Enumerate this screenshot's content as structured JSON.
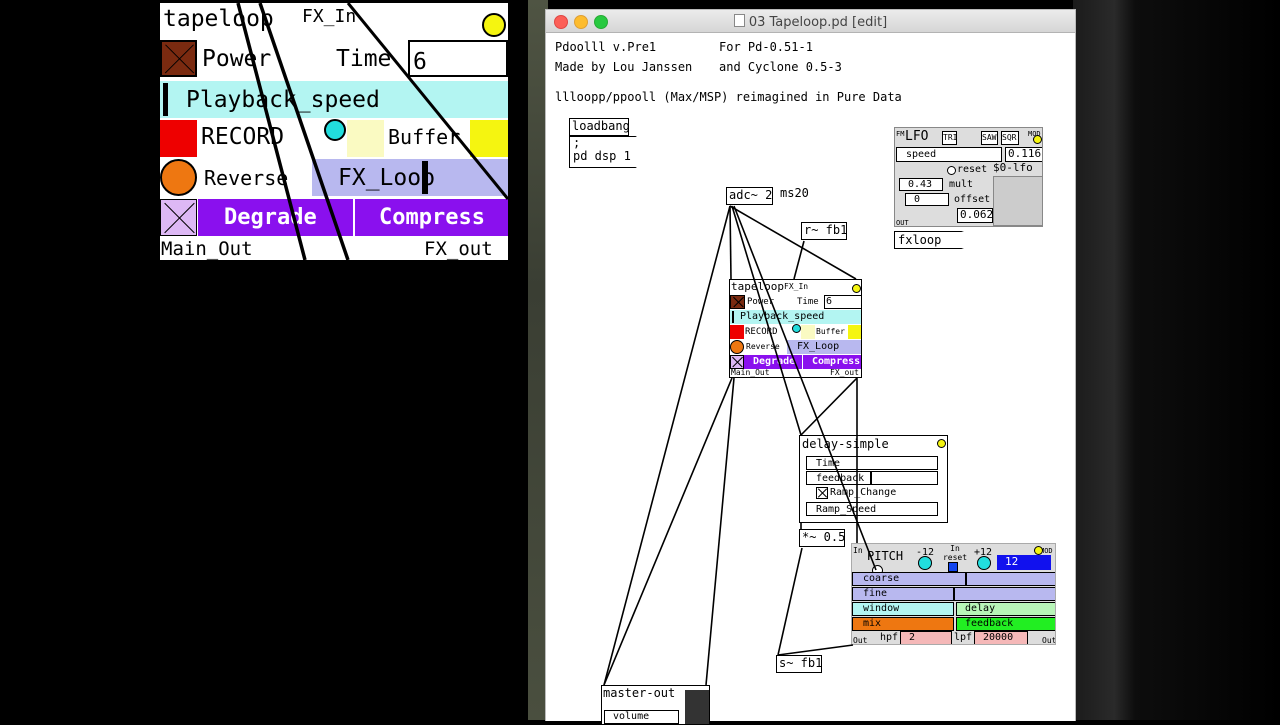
{
  "window": {
    "title": "03 Tapeloop.pd [edit]"
  },
  "zoom_panel": {
    "title": "tapeloop",
    "fx_in": "FX_In",
    "power": "Power",
    "time_label": "Time",
    "time_value": "6",
    "playback": "Playback_speed",
    "record": "RECORD",
    "buffer": "Buffer",
    "reverse": "Reverse",
    "fx_loop": "FX_Loop",
    "degrade": "Degrade",
    "compress": "Compress",
    "main_out": "Main_Out",
    "fx_out": "FX_out"
  },
  "comments": {
    "line1a": "Pdoolll v.Pre1",
    "line1b": "For Pd-0.51-1",
    "line2a": "Made by Lou Janssen",
    "line2b": "and Cyclone 0.5-3",
    "line3": "llloopp/ppooll (Max/MSP) reimagined in Pure Data",
    "ms20": "ms20"
  },
  "objects": {
    "loadbang": "loadbang",
    "dsp_msg1": ";",
    "dsp_msg2": "pd dsp 1",
    "adc": "adc~ 2",
    "rfb": "r~ fb1",
    "mul": "*~ 0.5",
    "sfb": "s~ fb1",
    "fxloop": "fxloop $1",
    "master": "master-out",
    "volume": "volume"
  },
  "tapeloop_small": {
    "title": "tapeloop",
    "fx_in": "FX_In",
    "power": "Power",
    "time_label": "Time",
    "time_value": "6",
    "playback": "Playback_speed",
    "record": "RECORD",
    "buffer": "Buffer",
    "reverse": "Reverse",
    "fx_loop": "FX_Loop",
    "degrade": "Degrade",
    "compress": "Compress",
    "main_out": "Main_Out",
    "fx_out": "FX_out"
  },
  "lfo": {
    "fm": "FM",
    "title": "LFO",
    "tri": "TRI",
    "saw": "SAW",
    "sqr": "SQR",
    "mod": "MOD",
    "speed": "speed",
    "speed_value": "0.116",
    "reset": "reset",
    "name": "$0-lfo",
    "mult_value": "0.43",
    "mult": "mult",
    "offset_value": "0",
    "offset": "offset",
    "out_value": "0.062",
    "out": "OUT"
  },
  "delay": {
    "title": "delay-simple",
    "time": "Time",
    "feedback": "feedback",
    "ramp_change": "Ramp_Change",
    "ramp_speed": "Ramp_Speed"
  },
  "pitch": {
    "in": "In",
    "title": "PITCH",
    "minus12": "-12",
    "in_reset": "In reset",
    "plus12": "+12",
    "value": "12",
    "mod": "MOD",
    "coarse": "coarse",
    "fine": "fine",
    "window": "window",
    "delay": "delay",
    "mix": "mix",
    "feedback": "feedback",
    "out": "Out",
    "hpf": "hpf",
    "hpf_value": "2",
    "lpf": "lpf",
    "lpf_value": "20000",
    "out2": "Out"
  },
  "colors": {
    "cyan": "#b3f5f2",
    "yellow": "#f5f510",
    "red": "#ee0000",
    "orange": "#ee7711",
    "lavender": "#b8b8ef",
    "purple": "#8a10ee",
    "pale_yellow": "#fafac2"
  }
}
